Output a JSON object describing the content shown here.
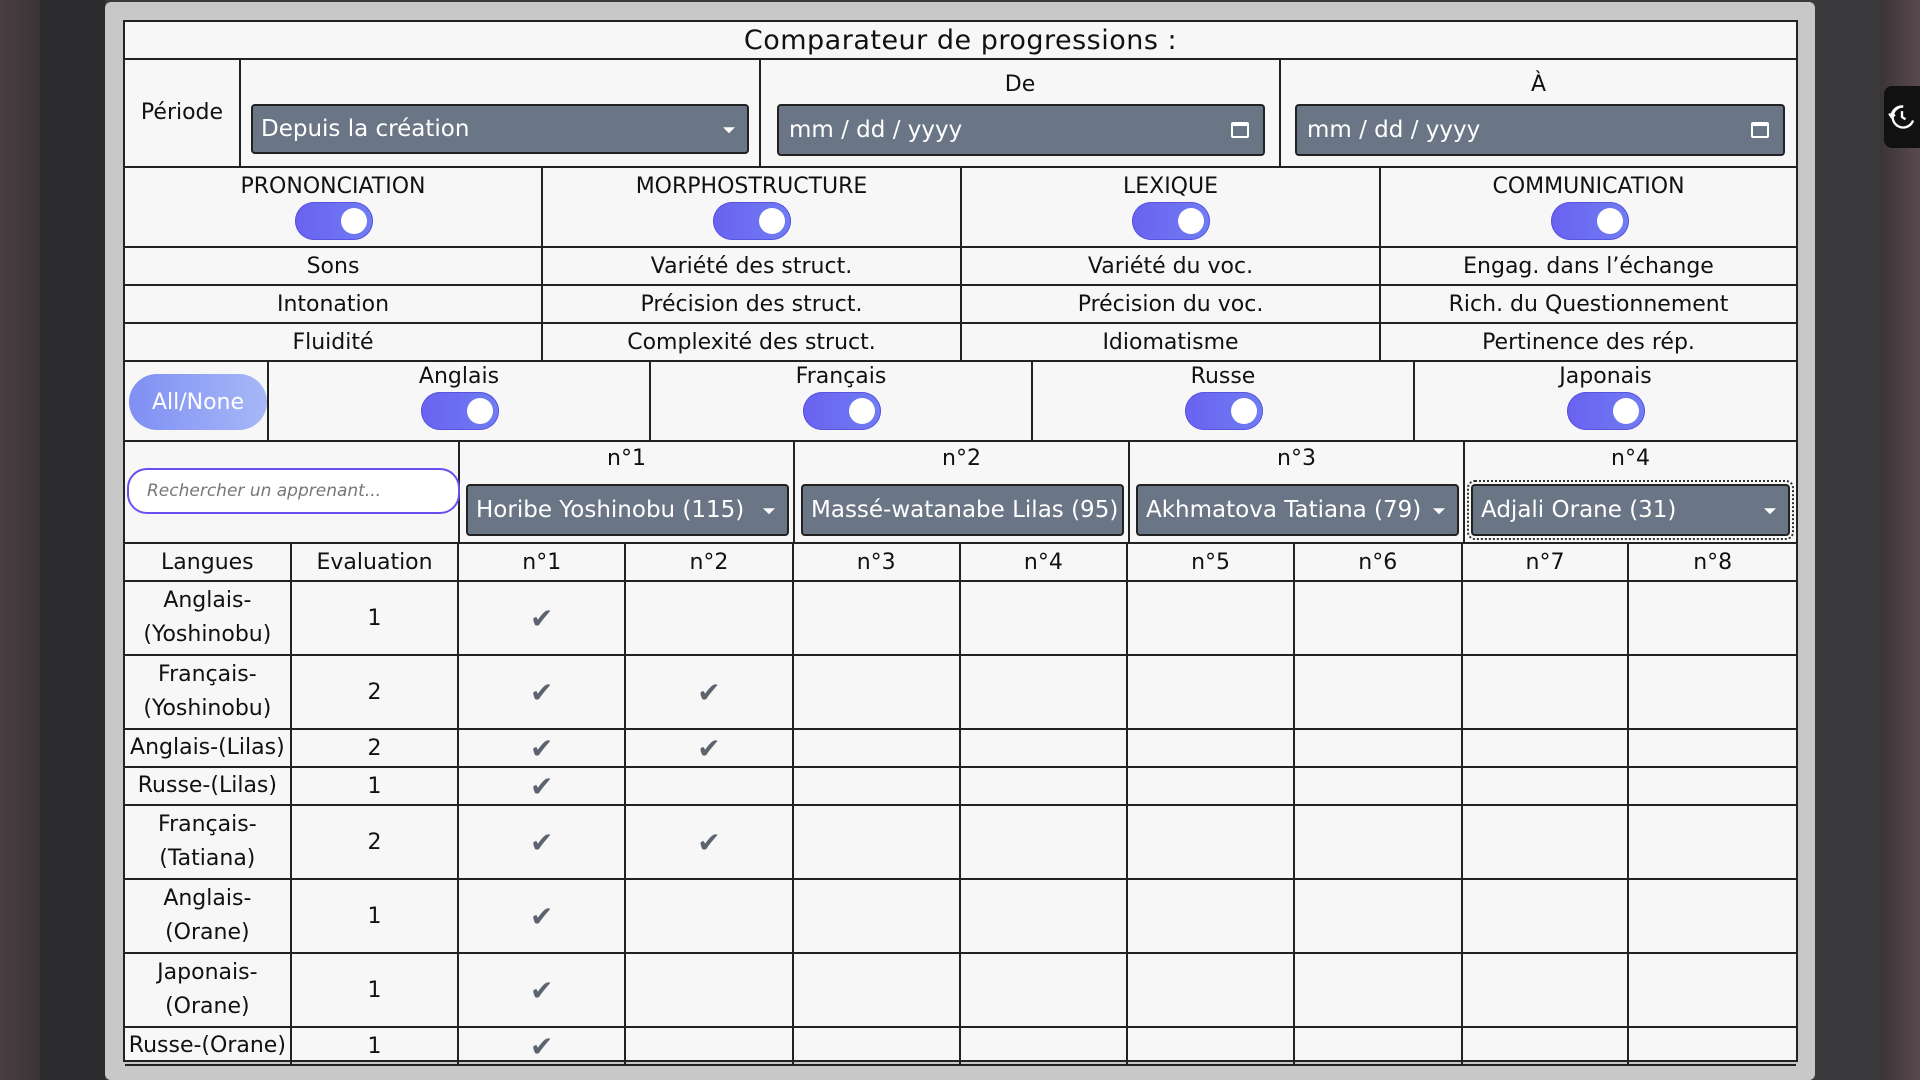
{
  "title": "Comparateur de progressions :",
  "period": {
    "label": "Période",
    "select_value": "Depuis la création",
    "from_label": "De",
    "to_label": "À",
    "from_placeholder": "mm / dd / yyyy",
    "to_placeholder": "mm / dd / yyyy"
  },
  "categories": [
    {
      "name": "PRONONCIATION",
      "on": true,
      "items": [
        "Sons",
        "Intonation",
        "Fluidité"
      ]
    },
    {
      "name": "MORPHOSTRUCTURE",
      "on": true,
      "items": [
        "Variété des struct.",
        "Précision des struct.",
        "Complexité des struct."
      ]
    },
    {
      "name": "LEXIQUE",
      "on": true,
      "items": [
        "Variété du voc.",
        "Précision du voc.",
        "Idiomatisme"
      ]
    },
    {
      "name": "COMMUNICATION",
      "on": true,
      "items": [
        "Engag. dans l’échange",
        "Rich. du Questionnement",
        "Pertinence des rép."
      ]
    }
  ],
  "languages": {
    "all_none_label": "All/None",
    "items": [
      {
        "name": "Anglais",
        "on": true
      },
      {
        "name": "Français",
        "on": true
      },
      {
        "name": "Russe",
        "on": true
      },
      {
        "name": "Japonais",
        "on": true
      }
    ]
  },
  "learners": {
    "search_placeholder": "Rechercher un apprenant...",
    "slots": [
      {
        "label": "n°1",
        "value": "Horibe Yoshinobu (115)"
      },
      {
        "label": "n°2",
        "value": "Massé-watanabe Lilas (95)"
      },
      {
        "label": "n°3",
        "value": "Akhmatova Tatiana (79)"
      },
      {
        "label": "n°4",
        "value": "Adjali Orane (31)"
      }
    ]
  },
  "table": {
    "headers": [
      "Langues",
      "Evaluation",
      "n°1",
      "n°2",
      "n°3",
      "n°4",
      "n°5",
      "n°6",
      "n°7",
      "n°8"
    ],
    "check_mark": "✔",
    "rows": [
      {
        "lang": [
          "Anglais-",
          "(Yoshinobu)"
        ],
        "eval": "1",
        "checks": [
          true,
          false,
          false,
          false,
          false,
          false,
          false,
          false
        ]
      },
      {
        "lang": [
          "Français-",
          "(Yoshinobu)"
        ],
        "eval": "2",
        "checks": [
          true,
          true,
          false,
          false,
          false,
          false,
          false,
          false
        ]
      },
      {
        "lang": [
          "Anglais-(Lilas)"
        ],
        "eval": "2",
        "checks": [
          true,
          true,
          false,
          false,
          false,
          false,
          false,
          false
        ]
      },
      {
        "lang": [
          "Russe-(Lilas)"
        ],
        "eval": "1",
        "checks": [
          true,
          false,
          false,
          false,
          false,
          false,
          false,
          false
        ]
      },
      {
        "lang": [
          "Français-",
          "(Tatiana)"
        ],
        "eval": "2",
        "checks": [
          true,
          true,
          false,
          false,
          false,
          false,
          false,
          false
        ]
      },
      {
        "lang": [
          "Anglais-",
          "(Orane)"
        ],
        "eval": "1",
        "checks": [
          true,
          false,
          false,
          false,
          false,
          false,
          false,
          false
        ]
      },
      {
        "lang": [
          "Japonais-",
          "(Orane)"
        ],
        "eval": "1",
        "checks": [
          true,
          false,
          false,
          false,
          false,
          false,
          false,
          false
        ]
      },
      {
        "lang": [
          "Russe-(Orane)"
        ],
        "eval": "1",
        "checks": [
          true,
          false,
          false,
          false,
          false,
          false,
          false,
          false
        ]
      }
    ]
  },
  "colors": {
    "toggle": "#6a62f0",
    "dropdown": "#6a7585",
    "search_border": "#6a4ff0"
  },
  "icons": {
    "history": "history-icon",
    "calendar": "calendar-icon"
  }
}
